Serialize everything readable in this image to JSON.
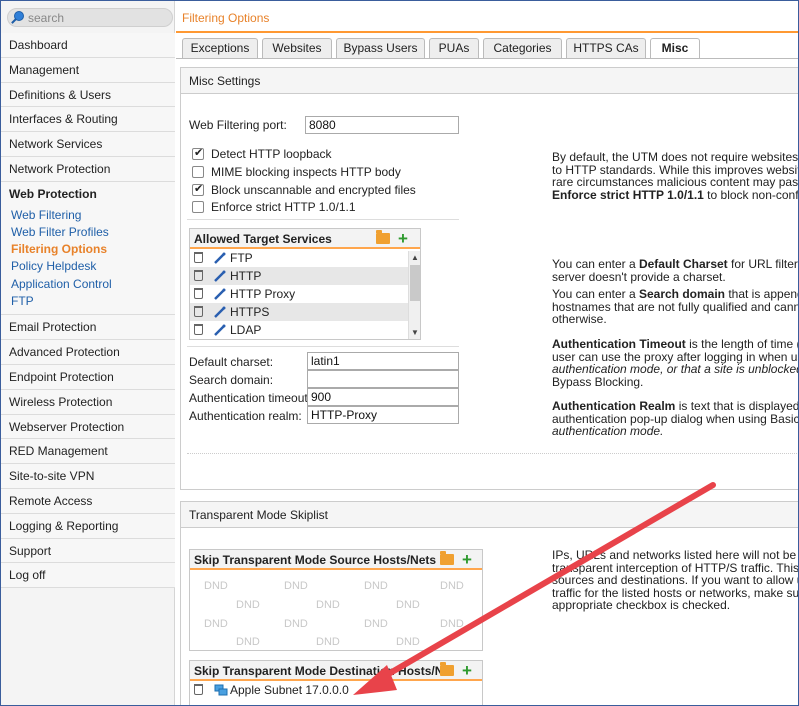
{
  "search": {
    "placeholder": "search"
  },
  "sidebar": {
    "items": [
      "Dashboard",
      "Management",
      "Definitions & Users",
      "Interfaces & Routing",
      "Network Services",
      "Network Protection",
      "Web Protection"
    ],
    "web_protection_sub": [
      "Web Filtering",
      "Web Filter Profiles",
      "Filtering Options",
      "Policy Helpdesk",
      "Application Control",
      "FTP"
    ],
    "items_after": [
      "Email Protection",
      "Advanced Protection",
      "Endpoint Protection",
      "Wireless Protection",
      "Webserver Protection",
      "RED Management",
      "Site-to-site VPN",
      "Remote Access",
      "Logging & Reporting",
      "Support",
      "Log off"
    ]
  },
  "page": {
    "title": "Filtering Options"
  },
  "tabs": [
    "Exceptions",
    "Websites",
    "Bypass Users",
    "PUAs",
    "Categories",
    "HTTPS CAs",
    "Misc"
  ],
  "misc": {
    "heading": "Misc Settings",
    "port_label": "Web Filtering port:",
    "port_value": "8080",
    "checks": [
      {
        "label": "Detect HTTP loopback",
        "checked": true
      },
      {
        "label": "MIME blocking inspects HTTP body",
        "checked": false
      },
      {
        "label": "Block unscannable and encrypted files",
        "checked": true
      },
      {
        "label": "Enforce strict HTTP 1.0/1.1",
        "checked": false
      }
    ],
    "services_title": "Allowed Target Services",
    "services": [
      "FTP",
      "HTTP",
      "HTTP Proxy",
      "HTTPS",
      "LDAP"
    ],
    "charset_label": "Default charset:",
    "charset_value": "latin1",
    "search_domain_label": "Search domain:",
    "search_domain_value": "",
    "timeout_label": "Authentication timeout:",
    "timeout_value": "900",
    "realm_label": "Authentication realm:",
    "realm_value": "HTTP-Proxy",
    "help1": "By default, the UTM does not require websites to c\nto HTTP standards. While this improves website c\nrare circumstances malicious content may pass u",
    "help1_bold_pre": "Enforce strict HTTP 1.0/1.1",
    "help1_bold_post": " to block non-conform",
    "help2_pre": "You can enter a ",
    "help2_bold": "Default Charset",
    "help2_post": " for URL filtering",
    "help2_line2": "server doesn't provide a charset.",
    "help3_pre": "You can enter a ",
    "help3_bold": "Search domain",
    "help3_post": " that is appended",
    "help3_line2": "hostnames that are not fully qualified and cannot",
    "help3_line3": "otherwise.",
    "help4_bold": "Authentication Timeout",
    "help4_post": " is the length of time (in se",
    "help4_line2": "user can use the proxy after logging in when using",
    "help4_line3": "authentication mode, or that a site is unblocked w",
    "help4_line4": "Bypass Blocking.",
    "help5_bold": "Authentication Realm",
    "help5_post": " is text that is displayed in t",
    "help5_line2": "authentication pop-up dialog when using Basic U",
    "help5_line3": "authentication mode."
  },
  "skiplist": {
    "heading": "Transparent Mode Skiplist",
    "source_title": "Skip Transparent Mode Source Hosts/Nets",
    "dest_title": "Skip Transparent Mode Destination Hosts/N...",
    "dnd": "DND",
    "dest_items": [
      "Apple Subnet 17.0.0.0"
    ],
    "help": "IPs, URLs and networks listed here will not be sub\ntransparent interception of HTTP/S traffic. This affe\nsources and destinations. If you want to allow unp\ntraffic for the listed hosts or networks, make sure t\nappropriate checkbox is checked."
  },
  "colors": {
    "accent": "#ff9933",
    "link": "#1f5fa8",
    "annotation_arrow": "#e8434a"
  }
}
